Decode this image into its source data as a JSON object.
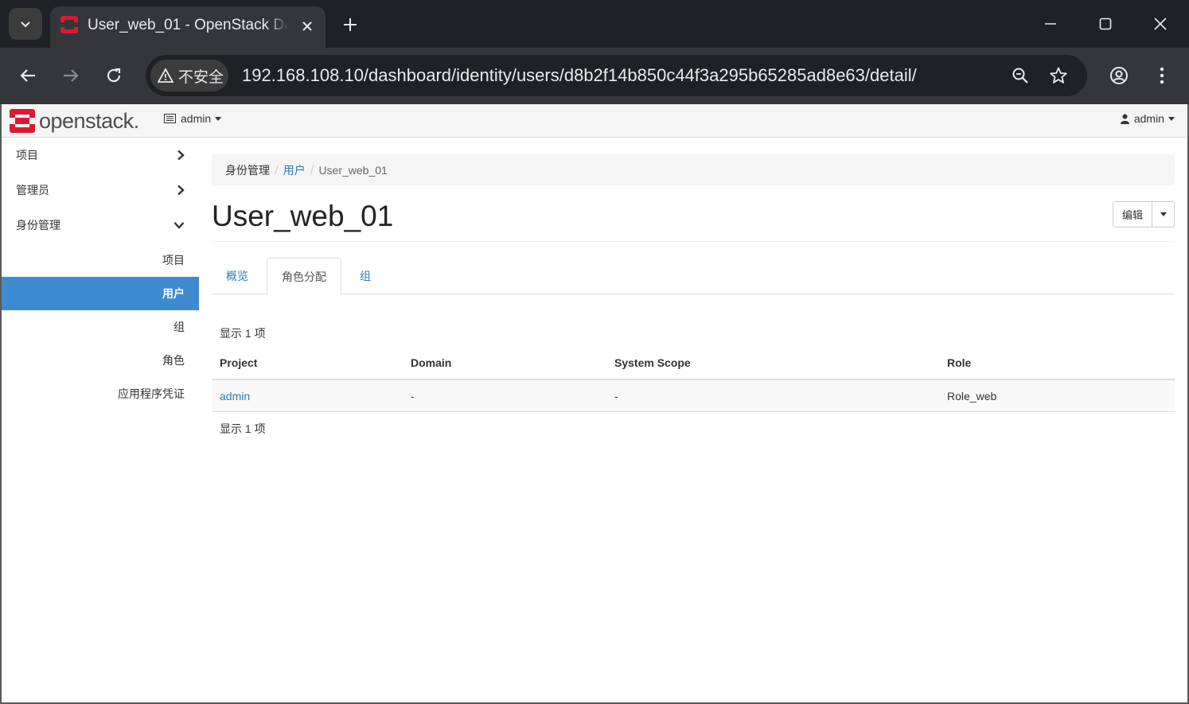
{
  "browser": {
    "tab_title": "User_web_01 - OpenStack Dashboard",
    "security_label": "不安全",
    "url": "192.168.108.10/dashboard/identity/users/d8b2f14b850c44f3a295b65285ad8e63/detail/"
  },
  "topbar": {
    "logo_text": "openstack.",
    "project": "admin",
    "user": "admin"
  },
  "sidebar": {
    "items": [
      {
        "label": "项目"
      },
      {
        "label": "管理员"
      },
      {
        "label": "身份管理"
      }
    ],
    "subitems": [
      {
        "label": "项目"
      },
      {
        "label": "用户"
      },
      {
        "label": "组"
      },
      {
        "label": "角色"
      },
      {
        "label": "应用程序凭证"
      }
    ]
  },
  "breadcrumb": {
    "root": "身份管理",
    "parent": "用户",
    "current": "User_web_01"
  },
  "page": {
    "title": "User_web_01",
    "edit_label": "编辑"
  },
  "tabs": [
    {
      "label": "概览"
    },
    {
      "label": "角色分配"
    },
    {
      "label": "组"
    }
  ],
  "table": {
    "count_top": "显示 1 项",
    "count_bottom": "显示 1 项",
    "columns": [
      "Project",
      "Domain",
      "System Scope",
      "Role"
    ],
    "rows": [
      [
        "admin",
        "-",
        "-",
        "Role_web"
      ]
    ]
  },
  "colors": {
    "accent": "#3d8ad0",
    "link": "#337ab7",
    "brand": "#da1a32"
  }
}
